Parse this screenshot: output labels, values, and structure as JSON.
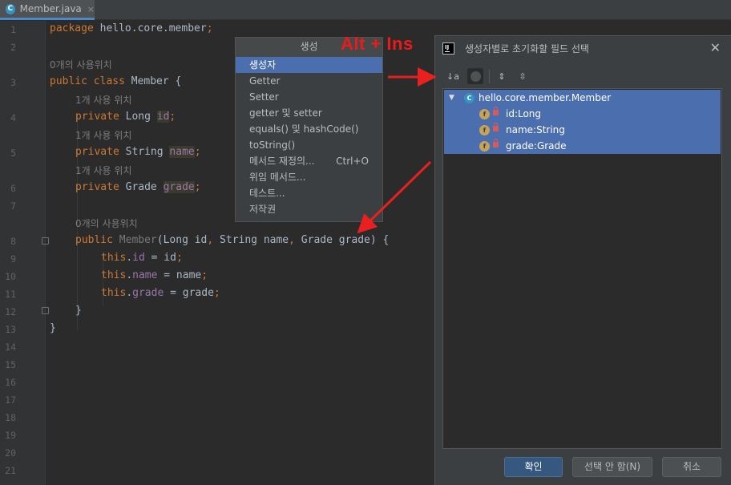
{
  "tab": {
    "icon": "class-c-icon",
    "icon_glyph": "C",
    "name": "Member.java",
    "close": "×"
  },
  "line_numbers": [
    "1",
    "2",
    "3",
    "4",
    "5",
    "6",
    "7",
    "8",
    "9",
    "10",
    "11",
    "12",
    "13",
    "14",
    "15",
    "16",
    "17",
    "18",
    "19",
    "20",
    "21"
  ],
  "code": {
    "l1_kw": "package",
    "l1_rest": " hello.core.member",
    "l1_semi": ";",
    "hint_class": "0개의 사용위치",
    "l3_kw": "public class",
    "l3_name": " Member ",
    "l3_brace": "{",
    "hint_id": "1개 사용 위치",
    "l4_kw": "private",
    "l4_type": " Long ",
    "l4_field": "id",
    "l4_semi": ";",
    "hint_name": "1개 사용 위치",
    "l5_kw": "private",
    "l5_type": " String ",
    "l5_field": "name",
    "l5_semi": ";",
    "hint_grade": "1개 사용 위치",
    "l6_kw": "private",
    "l6_type": " Grade ",
    "l6_field": "grade",
    "l6_semi": ";",
    "hint_ctor": "0개의 사용위치",
    "l8_kw": "public",
    "l8_name": " Member",
    "l8_p1": "(Long id",
    "l8_c1": ",",
    "l8_p2": " String name",
    "l8_c2": ",",
    "l8_p3": " Grade grade) {",
    "l9_this": "this",
    "l9_dot": ".",
    "l9_field": "id",
    "l9_rest": " = id",
    "l9_semi": ";",
    "l10_this": "this",
    "l10_dot": ".",
    "l10_field": "name",
    "l10_rest": " = name",
    "l10_semi": ";",
    "l11_this": "this",
    "l11_dot": ".",
    "l11_field": "grade",
    "l11_rest": " = grade",
    "l11_semi": ";",
    "l12": "}",
    "l13": "}"
  },
  "generate_popup": {
    "title": "생성",
    "items": [
      {
        "label": "생성자",
        "selected": true
      },
      {
        "label": "Getter"
      },
      {
        "label": "Setter"
      },
      {
        "label": "getter 및 setter"
      },
      {
        "label": "equals() 및 hashCode()"
      },
      {
        "label": "toString()"
      },
      {
        "label": "메서드 재정의...",
        "shortcut": "Ctrl+O"
      },
      {
        "label": "위임 메서드..."
      },
      {
        "label": "테스트..."
      },
      {
        "label": "저작권"
      }
    ]
  },
  "annotation": {
    "label": "Alt + Ins",
    "color": "#ee1a1a"
  },
  "dialog": {
    "title": "생성자별로 초기화할 필드 선택",
    "logo": "IJ",
    "close": "✕",
    "toolbar": {
      "sort_icon": "sort-alphabetically-icon",
      "sort_glyph": "↓a",
      "show_classes_icon": "show-classes-icon",
      "expand_all_icon": "expand-all-icon",
      "expand_glyph": "⇕",
      "collapse_all_icon": "collapse-all-icon",
      "collapse_glyph": "⇳"
    },
    "tree": {
      "root": {
        "label": "hello.core.member.Member",
        "icon": "class-c-icon",
        "glyph": "C"
      },
      "fields": [
        {
          "label": "id:Long",
          "icon": "field-f-icon",
          "glyph": "f"
        },
        {
          "label": "name:String",
          "icon": "field-f-icon",
          "glyph": "f"
        },
        {
          "label": "grade:Grade",
          "icon": "field-f-icon",
          "glyph": "f"
        }
      ]
    },
    "buttons": {
      "ok": "확인",
      "select_none": "선택 안 함(N)",
      "cancel": "취소"
    }
  },
  "colors": {
    "editor_bg": "#2b2b2b",
    "keyword": "#cc7832",
    "field": "#9876aa",
    "selection": "#4b6eaf",
    "primary_button": "#365880"
  }
}
